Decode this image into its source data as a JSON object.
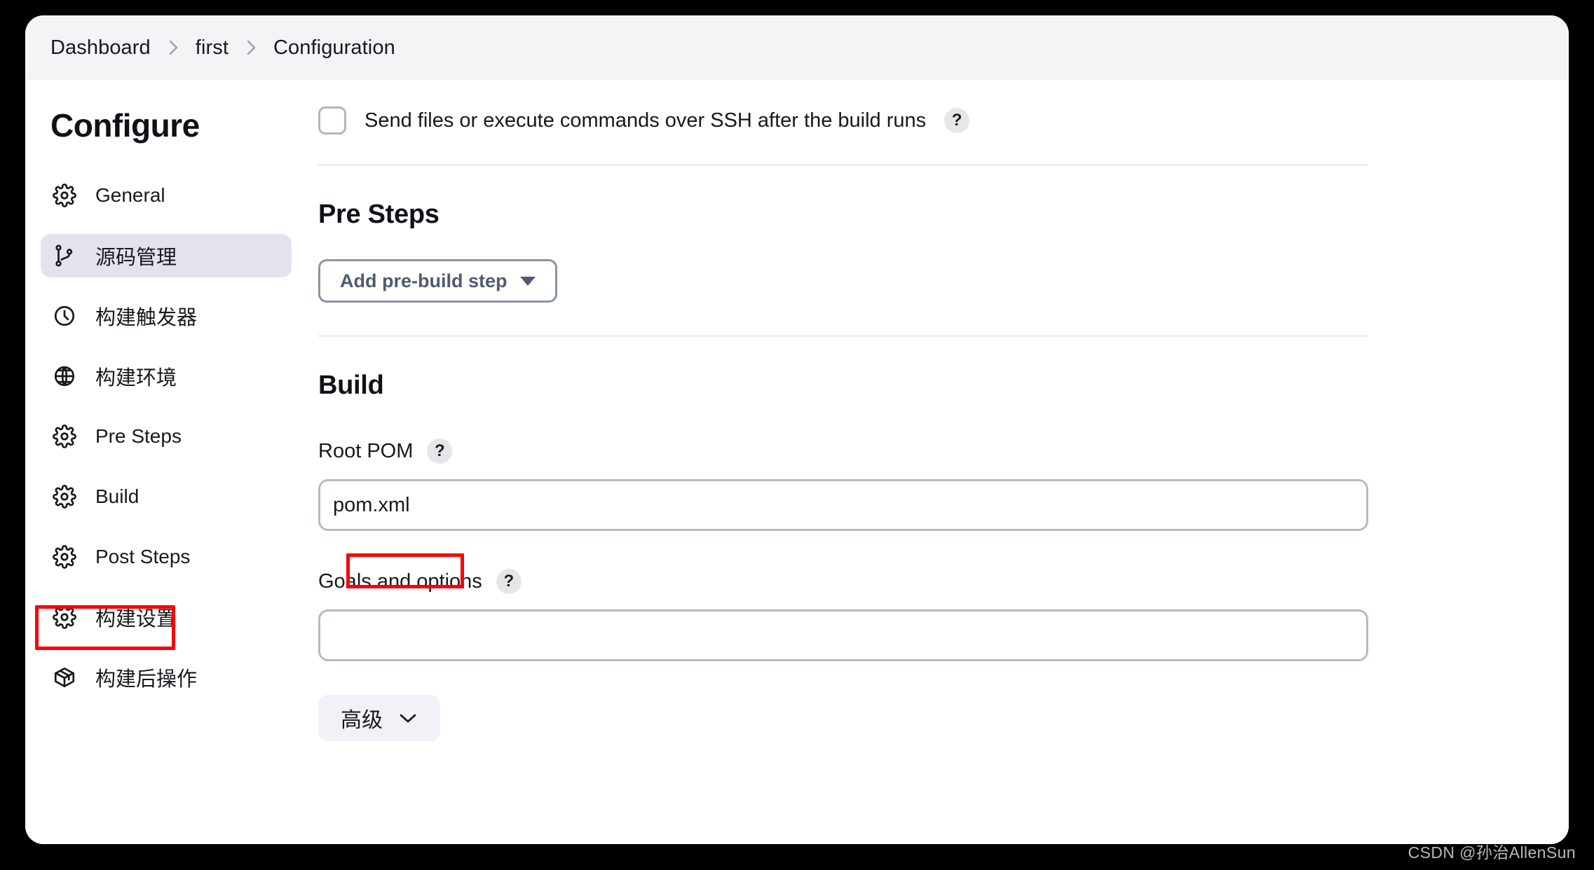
{
  "breadcrumb": {
    "items": [
      "Dashboard",
      "first",
      "Configuration"
    ],
    "separator": "chevron-right-icon"
  },
  "sidebar": {
    "title": "Configure",
    "items": [
      {
        "label": "General",
        "icon": "gear-icon",
        "active": false,
        "highlighted": false
      },
      {
        "label": "源码管理",
        "icon": "git-branch-icon",
        "active": true,
        "highlighted": false
      },
      {
        "label": "构建触发器",
        "icon": "clock-icon",
        "active": false,
        "highlighted": false
      },
      {
        "label": "构建环境",
        "icon": "globe-icon",
        "active": false,
        "highlighted": false
      },
      {
        "label": "Pre Steps",
        "icon": "gear-icon",
        "active": false,
        "highlighted": false
      },
      {
        "label": "Build",
        "icon": "gear-icon",
        "active": false,
        "highlighted": true
      },
      {
        "label": "Post Steps",
        "icon": "gear-icon",
        "active": false,
        "highlighted": false
      },
      {
        "label": "构建设置",
        "icon": "gear-icon",
        "active": false,
        "highlighted": false
      },
      {
        "label": "构建后操作",
        "icon": "package-icon",
        "active": false,
        "highlighted": false
      }
    ]
  },
  "main": {
    "ssh_checkbox": {
      "label": "Send files or execute commands over SSH after the build runs",
      "checked": false,
      "help": "?"
    },
    "pre_steps": {
      "title": "Pre Steps",
      "add_button_label": "Add pre-build step"
    },
    "build": {
      "title": "Build",
      "root_pom": {
        "label": "Root POM",
        "help": "?",
        "value": "pom.xml",
        "placeholder": ""
      },
      "goals": {
        "label": "Goals and options",
        "help": "?",
        "value": "",
        "placeholder": ""
      },
      "advanced_button_label": "高级"
    }
  },
  "annotations": {
    "highlight_color": "#fb0007",
    "boxes": [
      "build-nav-item",
      "pom-xml-value"
    ]
  },
  "watermark": {
    "text": "CSDN @孙治AllenSun"
  }
}
